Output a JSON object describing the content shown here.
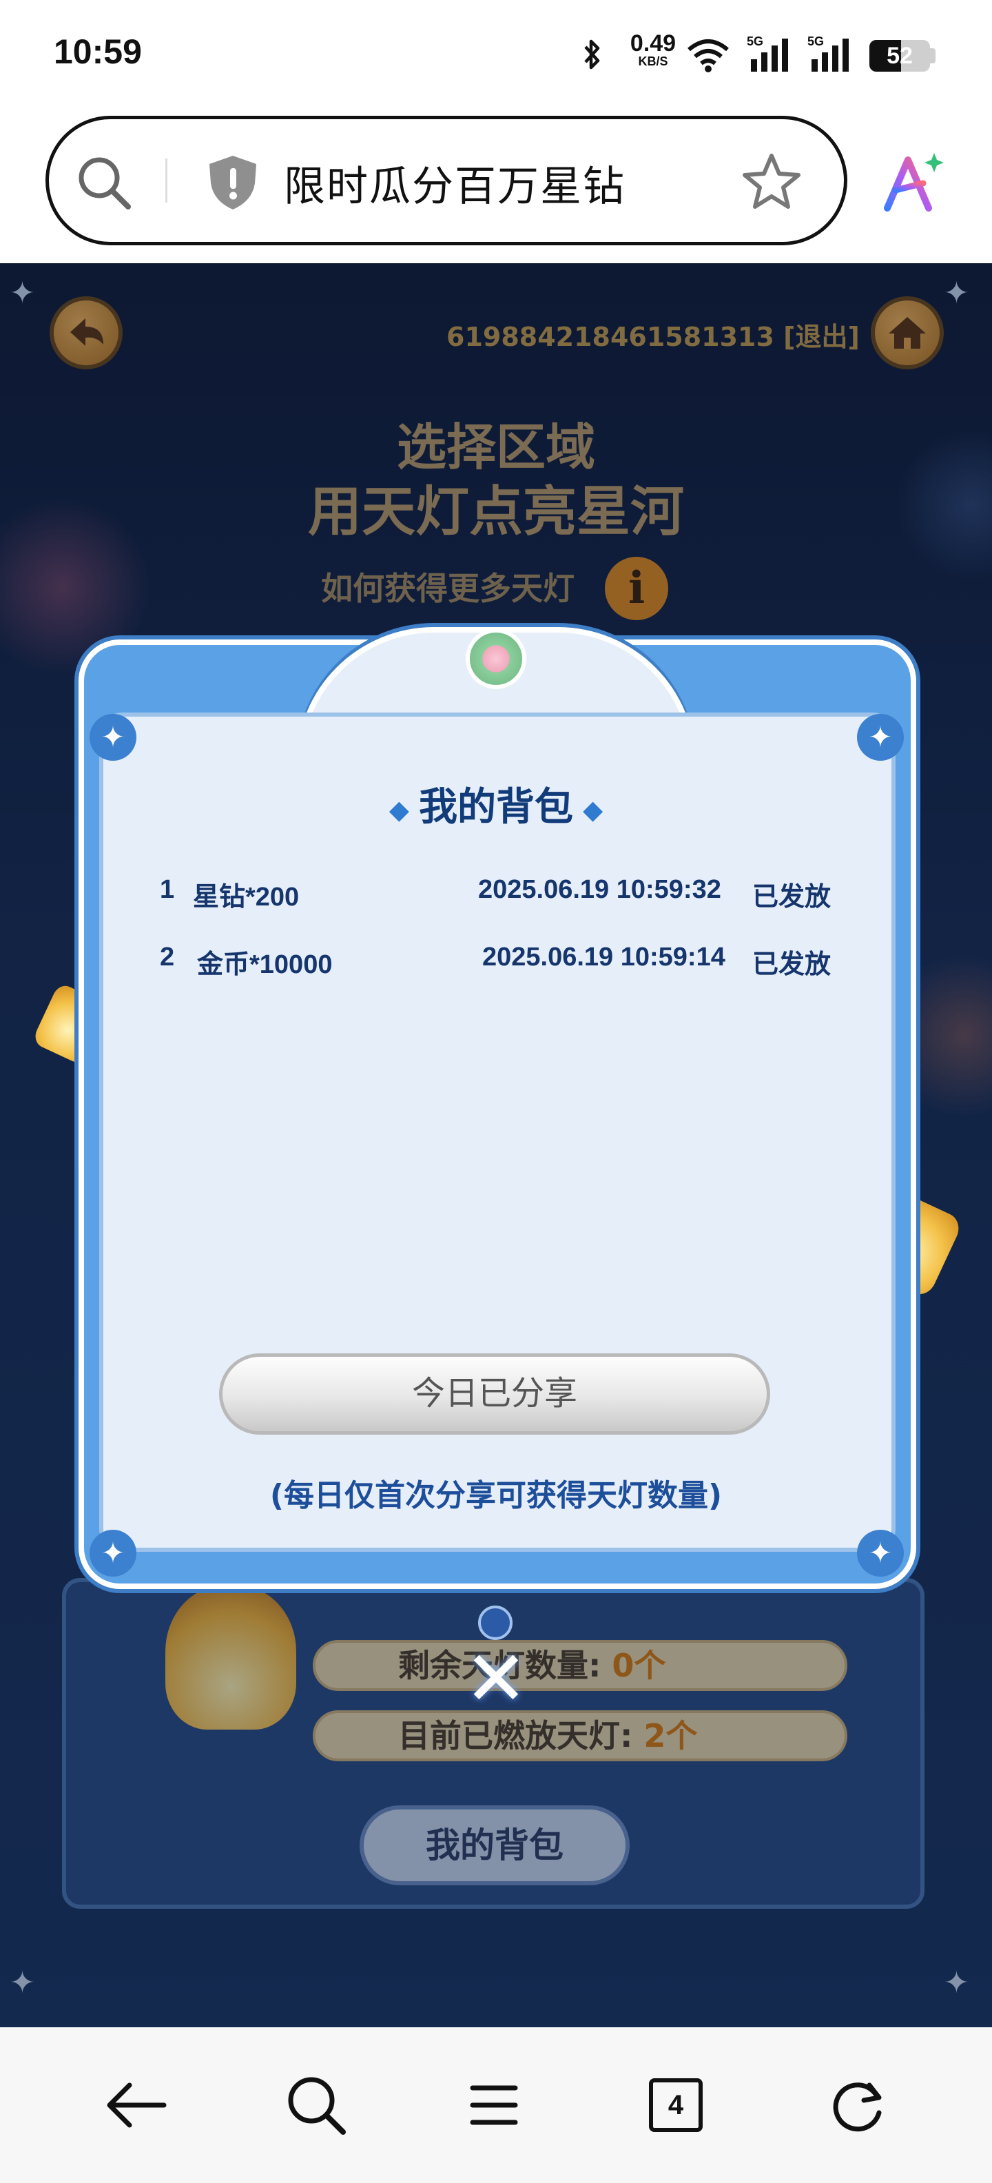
{
  "status_bar": {
    "time": "10:59",
    "net_speed": "0.49",
    "net_speed_unit": "KB/S",
    "network_label": "5G",
    "battery_level": "52",
    "icons": [
      "bluetooth-icon",
      "wifi-icon",
      "signal-5g-icon",
      "signal-5g-icon",
      "battery-icon"
    ]
  },
  "address_bar": {
    "page_title": "限时瓜分百万星钻",
    "icons": [
      "search-icon",
      "security-shield-icon",
      "bookmark-star-icon",
      "ai-assistant-icon"
    ]
  },
  "page": {
    "account_id": "619884218461581313",
    "logout_label": "[退出]",
    "title_line1": "选择区域",
    "title_line2": "用天灯点亮星河",
    "help_text": "如何获得更多天灯",
    "help_icon_glyph": "i",
    "remaining_label": "剩余天灯数量: ",
    "remaining_value": "0个",
    "lit_label": "目前已燃放天灯: ",
    "lit_value": "2个",
    "my_bag_button": "我的背包"
  },
  "modal": {
    "title": "我的背包",
    "items": [
      {
        "index": "1",
        "name": "星钻*200",
        "time": "2025.06.19 10:59:32",
        "status": "已发放"
      },
      {
        "index": "2",
        "name": "金币*10000",
        "time": "2025.06.19 10:59:14",
        "status": "已发放"
      }
    ],
    "share_button": "今日已分享",
    "share_note": "(每日仅首次分享可获得天灯数量)",
    "close_glyph": "✕"
  },
  "nav_bar": {
    "tabs_count": "4",
    "icons": [
      "back-arrow-icon",
      "search-icon",
      "menu-icon",
      "tabs-icon",
      "refresh-icon"
    ]
  },
  "colors": {
    "page_bg": "#172c52",
    "gold_text": "#c29a4a",
    "modal_blue": "#5aa1e6",
    "modal_text": "#15356c",
    "accent_orange": "#d67b0e"
  }
}
